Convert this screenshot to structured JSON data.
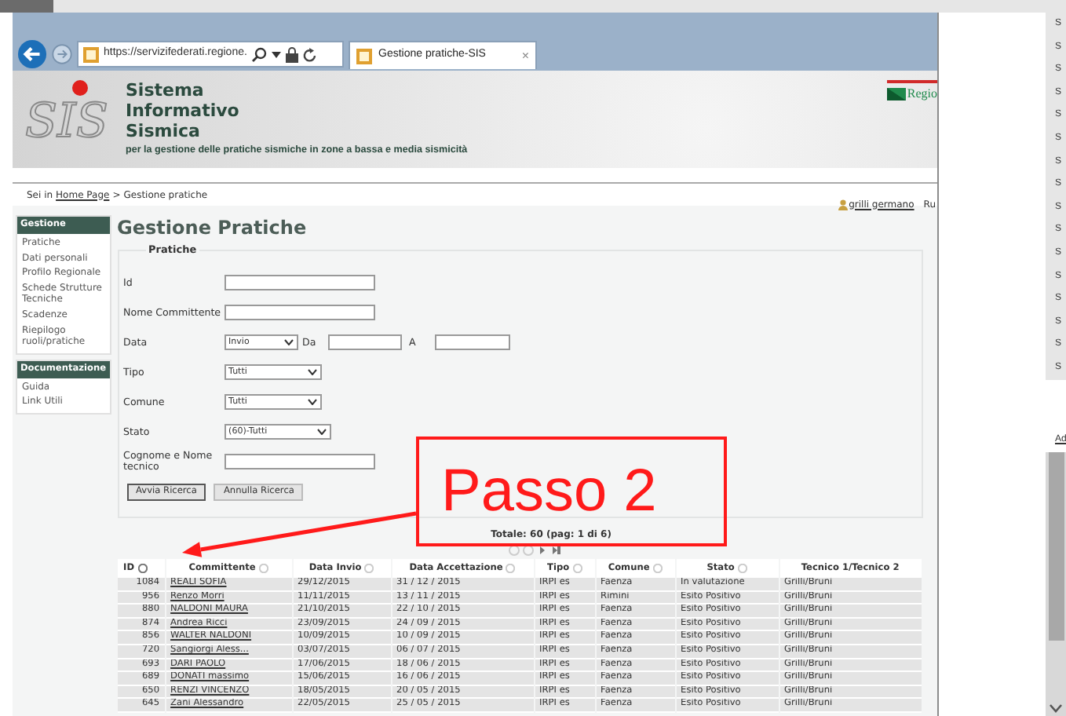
{
  "browser": {
    "url": "https://servizifederati.regione.",
    "tab_title": "Gestione pratiche-SIS",
    "tab_close": "×"
  },
  "header": {
    "logo_text": "SIS",
    "title_lines": [
      "Sistema",
      "Informativo",
      "Sismica"
    ],
    "subtitle": "per la gestione delle pratiche sismiche in zone a bassa e media sismicità",
    "region_logo_text": "Regio"
  },
  "breadcrumb": {
    "prefix": "Sei in",
    "link": "Home Page",
    "separator": ">",
    "current": "Gestione pratiche"
  },
  "user": {
    "name": "grilli germano",
    "extra": "Ru"
  },
  "sidebar": [
    {
      "title": "Gestione",
      "items": [
        "Pratiche",
        "Dati personali",
        "Profilo Regionale",
        "Schede Strutture Tecniche",
        "Scadenze",
        "Riepilogo ruoli/pratiche"
      ]
    },
    {
      "title": "Documentazione",
      "items": [
        "Guida",
        "Link Utili"
      ]
    }
  ],
  "page_title": "Gestione Pratiche",
  "form": {
    "legend": "Pratiche",
    "fields": [
      {
        "kind": "text",
        "label": "Id"
      },
      {
        "kind": "text",
        "label": "Nome Committente"
      },
      {
        "kind": "date_range",
        "label": "Data",
        "value": "Invio",
        "from_label": "Da",
        "to_label": "A"
      },
      {
        "kind": "select",
        "label": "Tipo",
        "value": "Tutti"
      },
      {
        "kind": "select",
        "label": "Comune",
        "value": "Tutti"
      },
      {
        "kind": "select",
        "label": "Stato",
        "value": "(60)-Tutti"
      },
      {
        "kind": "text",
        "label": "Cognome e Nome tecnico"
      }
    ],
    "buttons": [
      "Avvia Ricerca",
      "Annulla Ricerca"
    ]
  },
  "annotation": {
    "text": "Passo 2"
  },
  "results": {
    "total": "Totale: 60 (pag: 1 di 6)",
    "columns": [
      {
        "label": "ID",
        "sortable": true
      },
      {
        "label": "Committente",
        "sortable": true
      },
      {
        "label": "Data Invio",
        "sortable": true
      },
      {
        "label": "Data Accettazione",
        "sortable": true
      },
      {
        "label": "Tipo",
        "sortable": true
      },
      {
        "label": "Comune",
        "sortable": true
      },
      {
        "label": "Stato",
        "sortable": true
      },
      {
        "label": "Tecnico 1/Tecnico 2",
        "sortable": false
      }
    ],
    "rows": [
      [
        "1084",
        "REALI SOFIA",
        "29/12/2015",
        "31 / 12 / 2015",
        "IRPI es",
        "Faenza",
        "In valutazione",
        "Grilli/Bruni"
      ],
      [
        "956",
        "Renzo Morri",
        "11/11/2015",
        "13 / 11 / 2015",
        "IRPI es",
        "Rimini",
        "Esito Positivo",
        "Grilli/Bruni"
      ],
      [
        "880",
        "NALDONI MAURA",
        "21/10/2015",
        "22 / 10 / 2015",
        "IRPI es",
        "Faenza",
        "Esito Positivo",
        "Grilli/Bruni"
      ],
      [
        "874",
        "Andrea Ricci",
        "23/09/2015",
        "24 / 09 / 2015",
        "IRPI es",
        "Faenza",
        "Esito Positivo",
        "Grilli/Bruni"
      ],
      [
        "856",
        "WALTER NALDONI",
        "10/09/2015",
        "10 / 09 / 2015",
        "IRPI es",
        "Faenza",
        "Esito Positivo",
        "Grilli/Bruni"
      ],
      [
        "720",
        "Sangiorgi Aless...",
        "03/07/2015",
        "06 / 07 / 2015",
        "IRPI es",
        "Faenza",
        "Esito Positivo",
        "Grilli/Bruni"
      ],
      [
        "693",
        "DARI PAOLO",
        "17/06/2015",
        "18 / 06 / 2015",
        "IRPI es",
        "Faenza",
        "Esito Positivo",
        "Grilli/Bruni"
      ],
      [
        "689",
        "DONATI massimo",
        "15/06/2015",
        "16 / 06 / 2015",
        "IRPI es",
        "Faenza",
        "Esito Positivo",
        "Grilli/Bruni"
      ],
      [
        "650",
        "RENZI VINCENZO",
        "18/05/2015",
        "20 / 05 / 2015",
        "IRPI es",
        "Faenza",
        "Esito Positivo",
        "Grilli/Bruni"
      ],
      [
        "645",
        "Zani Alessandro",
        "22/05/2015",
        "25 / 05 / 2015",
        "IRPI es",
        "Faenza",
        "Esito Positivo",
        "Grilli/Bruni"
      ]
    ]
  },
  "side_panel": {
    "list_items": [
      "S",
      "S",
      "S",
      "S",
      "S",
      "S",
      "S",
      "S",
      "S",
      "S",
      "S",
      "S",
      "S",
      "S",
      "S",
      "S"
    ],
    "link": "Ad"
  }
}
